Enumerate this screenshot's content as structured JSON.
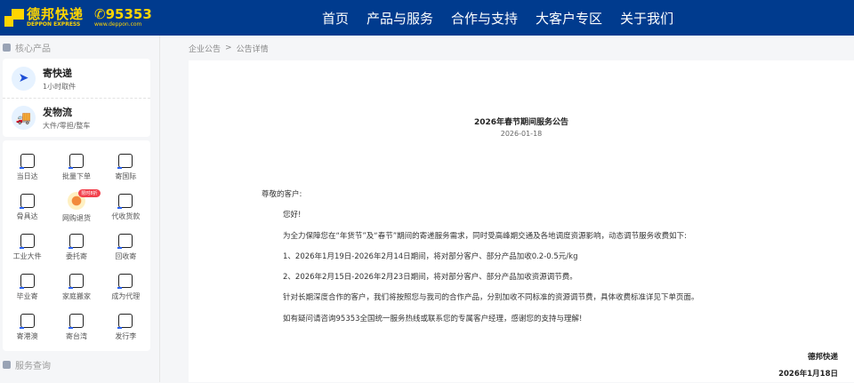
{
  "header": {
    "logo_cn": "德邦快递",
    "logo_en": "DEPPON EXPRESS",
    "phone": "95353",
    "website": "www.deppon.com",
    "nav": [
      "首页",
      "产品与服务",
      "合作与支持",
      "大客户专区",
      "关于我们"
    ]
  },
  "sidebar": {
    "core_title": "核心产品",
    "products": [
      {
        "title": "寄快递",
        "sub": "1小时取件",
        "icon": "paper-plane-icon"
      },
      {
        "title": "发物流",
        "sub": "大件/零担/整车",
        "icon": "truck-icon"
      }
    ],
    "services": [
      {
        "label": "当日达"
      },
      {
        "label": "批量下单"
      },
      {
        "label": "寄国际"
      },
      {
        "label": "骨具达"
      },
      {
        "label": "网购退货",
        "badge": "限时8折"
      },
      {
        "label": "代收货款"
      },
      {
        "label": "工业大件"
      },
      {
        "label": "委托寄"
      },
      {
        "label": "回收寄"
      },
      {
        "label": "毕业寄"
      },
      {
        "label": "家庭搬家"
      },
      {
        "label": "成为代理"
      },
      {
        "label": "寄港澳"
      },
      {
        "label": "寄台湾"
      },
      {
        "label": "发行李"
      }
    ],
    "query_title": "服务查询"
  },
  "breadcrumb": {
    "parent": "企业公告",
    "sep": ">",
    "current": "公告详情"
  },
  "article": {
    "title": "2026年春节期间服务公告",
    "date": "2026-01-18",
    "greeting": "尊敬的客户:",
    "paragraphs": [
      "您好!",
      "为全力保障您在“年货节”及“春节”期间的寄递服务需求，同时受高峰期交通及各地调度资源影响，动态调节服务收费如下:",
      "1、2026年1月19日-2026年2月14日期间，将对部分客户、部分产品加收0.2-0.5元/kg",
      "2、2026年2月15日-2026年2月23日期间，将对部分客户、部分产品加收资源调节费。",
      "针对长期深度合作的客户，我们将按照您与我司的合作产品，分别加收不同标准的资源调节费，具体收费标准详见下单页面。",
      "如有疑问请咨询95353全国统一服务热线或联系您的专属客户经理，感谢您的支持与理解!"
    ],
    "signature": "德邦快递",
    "sign_date": "2026年1月18日"
  }
}
